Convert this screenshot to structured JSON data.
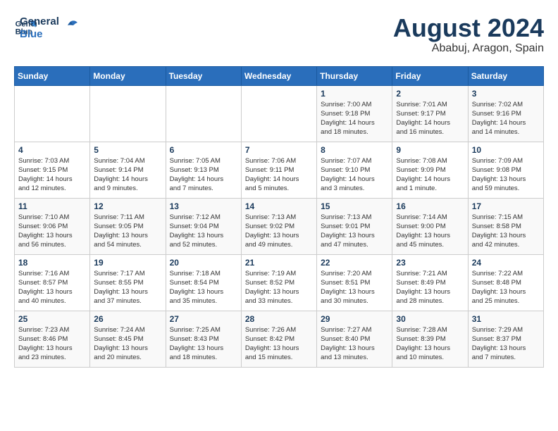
{
  "header": {
    "logo_line1": "General",
    "logo_line2": "Blue",
    "month_year": "August 2024",
    "location": "Ababuj, Aragon, Spain"
  },
  "weekdays": [
    "Sunday",
    "Monday",
    "Tuesday",
    "Wednesday",
    "Thursday",
    "Friday",
    "Saturday"
  ],
  "weeks": [
    [
      {
        "day": "",
        "info": ""
      },
      {
        "day": "",
        "info": ""
      },
      {
        "day": "",
        "info": ""
      },
      {
        "day": "",
        "info": ""
      },
      {
        "day": "1",
        "info": "Sunrise: 7:00 AM\nSunset: 9:18 PM\nDaylight: 14 hours\nand 18 minutes."
      },
      {
        "day": "2",
        "info": "Sunrise: 7:01 AM\nSunset: 9:17 PM\nDaylight: 14 hours\nand 16 minutes."
      },
      {
        "day": "3",
        "info": "Sunrise: 7:02 AM\nSunset: 9:16 PM\nDaylight: 14 hours\nand 14 minutes."
      }
    ],
    [
      {
        "day": "4",
        "info": "Sunrise: 7:03 AM\nSunset: 9:15 PM\nDaylight: 14 hours\nand 12 minutes."
      },
      {
        "day": "5",
        "info": "Sunrise: 7:04 AM\nSunset: 9:14 PM\nDaylight: 14 hours\nand 9 minutes."
      },
      {
        "day": "6",
        "info": "Sunrise: 7:05 AM\nSunset: 9:13 PM\nDaylight: 14 hours\nand 7 minutes."
      },
      {
        "day": "7",
        "info": "Sunrise: 7:06 AM\nSunset: 9:11 PM\nDaylight: 14 hours\nand 5 minutes."
      },
      {
        "day": "8",
        "info": "Sunrise: 7:07 AM\nSunset: 9:10 PM\nDaylight: 14 hours\nand 3 minutes."
      },
      {
        "day": "9",
        "info": "Sunrise: 7:08 AM\nSunset: 9:09 PM\nDaylight: 14 hours\nand 1 minute."
      },
      {
        "day": "10",
        "info": "Sunrise: 7:09 AM\nSunset: 9:08 PM\nDaylight: 13 hours\nand 59 minutes."
      }
    ],
    [
      {
        "day": "11",
        "info": "Sunrise: 7:10 AM\nSunset: 9:06 PM\nDaylight: 13 hours\nand 56 minutes."
      },
      {
        "day": "12",
        "info": "Sunrise: 7:11 AM\nSunset: 9:05 PM\nDaylight: 13 hours\nand 54 minutes."
      },
      {
        "day": "13",
        "info": "Sunrise: 7:12 AM\nSunset: 9:04 PM\nDaylight: 13 hours\nand 52 minutes."
      },
      {
        "day": "14",
        "info": "Sunrise: 7:13 AM\nSunset: 9:02 PM\nDaylight: 13 hours\nand 49 minutes."
      },
      {
        "day": "15",
        "info": "Sunrise: 7:13 AM\nSunset: 9:01 PM\nDaylight: 13 hours\nand 47 minutes."
      },
      {
        "day": "16",
        "info": "Sunrise: 7:14 AM\nSunset: 9:00 PM\nDaylight: 13 hours\nand 45 minutes."
      },
      {
        "day": "17",
        "info": "Sunrise: 7:15 AM\nSunset: 8:58 PM\nDaylight: 13 hours\nand 42 minutes."
      }
    ],
    [
      {
        "day": "18",
        "info": "Sunrise: 7:16 AM\nSunset: 8:57 PM\nDaylight: 13 hours\nand 40 minutes."
      },
      {
        "day": "19",
        "info": "Sunrise: 7:17 AM\nSunset: 8:55 PM\nDaylight: 13 hours\nand 37 minutes."
      },
      {
        "day": "20",
        "info": "Sunrise: 7:18 AM\nSunset: 8:54 PM\nDaylight: 13 hours\nand 35 minutes."
      },
      {
        "day": "21",
        "info": "Sunrise: 7:19 AM\nSunset: 8:52 PM\nDaylight: 13 hours\nand 33 minutes."
      },
      {
        "day": "22",
        "info": "Sunrise: 7:20 AM\nSunset: 8:51 PM\nDaylight: 13 hours\nand 30 minutes."
      },
      {
        "day": "23",
        "info": "Sunrise: 7:21 AM\nSunset: 8:49 PM\nDaylight: 13 hours\nand 28 minutes."
      },
      {
        "day": "24",
        "info": "Sunrise: 7:22 AM\nSunset: 8:48 PM\nDaylight: 13 hours\nand 25 minutes."
      }
    ],
    [
      {
        "day": "25",
        "info": "Sunrise: 7:23 AM\nSunset: 8:46 PM\nDaylight: 13 hours\nand 23 minutes."
      },
      {
        "day": "26",
        "info": "Sunrise: 7:24 AM\nSunset: 8:45 PM\nDaylight: 13 hours\nand 20 minutes."
      },
      {
        "day": "27",
        "info": "Sunrise: 7:25 AM\nSunset: 8:43 PM\nDaylight: 13 hours\nand 18 minutes."
      },
      {
        "day": "28",
        "info": "Sunrise: 7:26 AM\nSunset: 8:42 PM\nDaylight: 13 hours\nand 15 minutes."
      },
      {
        "day": "29",
        "info": "Sunrise: 7:27 AM\nSunset: 8:40 PM\nDaylight: 13 hours\nand 13 minutes."
      },
      {
        "day": "30",
        "info": "Sunrise: 7:28 AM\nSunset: 8:39 PM\nDaylight: 13 hours\nand 10 minutes."
      },
      {
        "day": "31",
        "info": "Sunrise: 7:29 AM\nSunset: 8:37 PM\nDaylight: 13 hours\nand 7 minutes."
      }
    ]
  ]
}
